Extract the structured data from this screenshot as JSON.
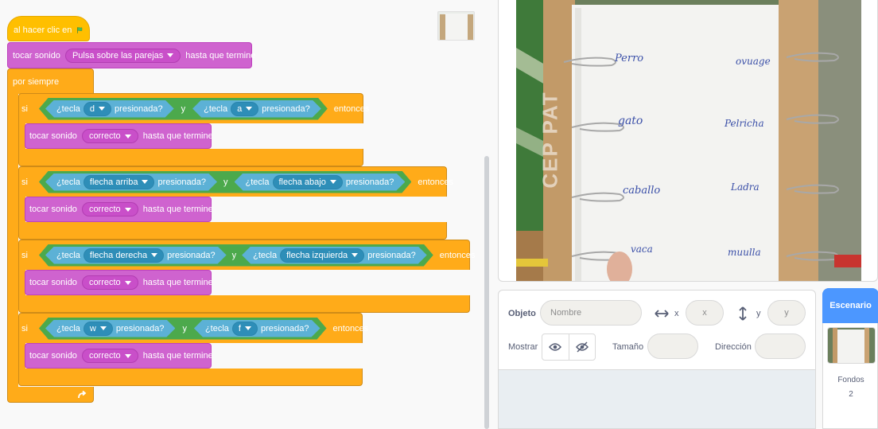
{
  "code": {
    "hat_label": "al hacer clic en",
    "play_sound_label": "tocar sonido",
    "play_sound_sound": "Pulsa sobre las parejas",
    "until_done": "hasta que termine",
    "forever_label": "por siempre",
    "if_label": "si",
    "then_label": "entonces",
    "and_label": "y",
    "key_label": "¿tecla",
    "pressed_label": "presionada?",
    "correct_sound": "correcto",
    "ifs": [
      {
        "k1": "d",
        "k2": "a"
      },
      {
        "k1": "flecha arriba",
        "k2": "flecha abajo"
      },
      {
        "k1": "flecha derecha",
        "k2": "flecha izquierda"
      },
      {
        "k1": "w",
        "k2": "f"
      }
    ]
  },
  "stage": {
    "words_left": [
      "Perro",
      "gato",
      "caballo",
      "vaca"
    ],
    "words_right": [
      "ovuage",
      "Pelricha",
      "Ladra",
      "muulla"
    ],
    "watermark": "CEP PAT"
  },
  "sprite_info": {
    "sprite_label": "Objeto",
    "name_placeholder": "Nombre",
    "x_label": "x",
    "x_placeholder": "x",
    "y_label": "y",
    "y_placeholder": "y",
    "show_label": "Mostrar",
    "size_label": "Tamaño",
    "direction_label": "Dirección"
  },
  "stage_panel": {
    "title": "Escenario",
    "backdrops_label": "Fondos",
    "backdrops_count": "2"
  },
  "colors": {
    "events": "#ffbf00",
    "sound": "#cf63cf",
    "control": "#ffab19",
    "operators": "#59c059",
    "sensing": "#5cb1d6",
    "accent": "#4c97ff"
  }
}
